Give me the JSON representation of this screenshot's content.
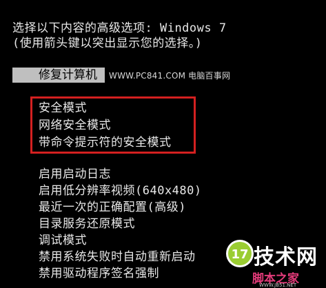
{
  "header": {
    "line1": "选择以下内容的高级选项: Windows 7",
    "line2": "(使用箭头键以突出显示您的选择。)"
  },
  "selected_item": {
    "label": "修复计算机"
  },
  "watermark": "WWW.PC841.COM 电脑百事网",
  "options": [
    {
      "label": "安全模式"
    },
    {
      "label": "网络安全模式"
    },
    {
      "label": "带命令提示符的安全模式"
    },
    {
      "label": "启用启动日志"
    },
    {
      "label": "启用低分辨率视频(640x480)"
    },
    {
      "label": "最近一次的正确配置(高级)"
    },
    {
      "label": "目录服务还原模式"
    },
    {
      "label": "调试模式"
    },
    {
      "label": "禁用系统失败时自动重新启动"
    },
    {
      "label": "禁用驱动程序签名强制"
    }
  ],
  "logo": {
    "text": "技术网",
    "sub": "脚本之家",
    "url": "WWW.JB51.NET",
    "icon": "17-circle-logo-icon"
  },
  "colors": {
    "background": "#000000",
    "text": "#e8e8e8",
    "selection_bar": "#bfbfbf",
    "highlight_box": "#d42020"
  }
}
